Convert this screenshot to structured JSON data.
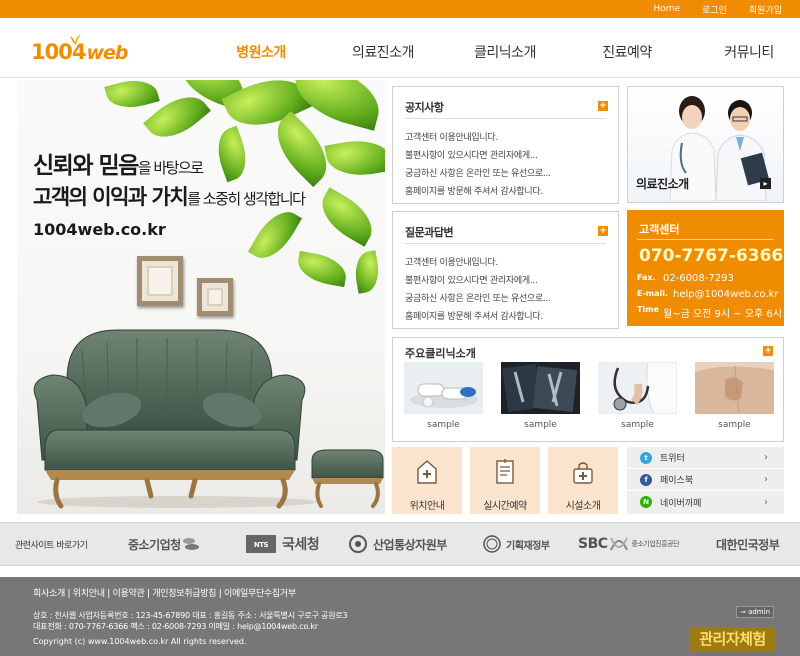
{
  "colors": {
    "accent": "#f08c00",
    "footer": "#777777",
    "quick": "#fbe4cd"
  },
  "topbar": {
    "links": [
      "Home",
      "로그인",
      "회원가입"
    ]
  },
  "logo": {
    "num": "1004",
    "text": "web"
  },
  "nav": {
    "items": [
      "병원소개",
      "의료진소개",
      "클리닉소개",
      "진료예약",
      "커뮤니티"
    ],
    "active": 0
  },
  "visual": {
    "line1_a": "신뢰와 믿음",
    "line1_b": "을 바탕으로",
    "line2_a": "고객의 이익과 가치",
    "line2_b": "를 소중히 생각합니다",
    "line3": "1004web.co.kr"
  },
  "notice": {
    "title": "공지사항",
    "items": [
      "고객센터 이용안내입니다.",
      "불편사항이 있으시다면 관리자에게...",
      "궁금하신 사항은 온라인 또는 유선으로...",
      "홈페이지를 방문해 주셔서 감사합니다."
    ]
  },
  "qna": {
    "title": "질문과답변",
    "items": [
      "고객센터 이용안내입니다.",
      "불편사항이 있으시다면 관리자에게...",
      "궁금하신 사항은 온라인 또는 유선으로...",
      "홈페이지를 방문해 주셔서 감사합니다."
    ]
  },
  "medical_staff": {
    "label": "의료진소개"
  },
  "customer_center": {
    "title": "고객센터",
    "phone": "070-7767-6366",
    "fax_label": "Fax.",
    "fax": "02-6008-7293",
    "email_label": "E-mail.",
    "email": "help@1004web.co.kr",
    "time_label": "Time",
    "time": "월~금 오전 9시 ~ 오후 6시"
  },
  "clinics": {
    "title": "주요클리닉소개",
    "items": [
      {
        "caption": "sample",
        "icon": "pills-image"
      },
      {
        "caption": "sample",
        "icon": "xray-image"
      },
      {
        "caption": "sample",
        "icon": "stethoscope-image"
      },
      {
        "caption": "sample",
        "icon": "back-massage-image"
      }
    ]
  },
  "quick": [
    {
      "label": "위치안내",
      "icon": "hospital-icon"
    },
    {
      "label": "실시간예약",
      "icon": "document-icon"
    },
    {
      "label": "시설소개",
      "icon": "medical-bag-icon"
    }
  ],
  "sns": [
    {
      "label": "트위터",
      "icon": "twitter-icon",
      "color": "#38a4dd"
    },
    {
      "label": "페이스북",
      "icon": "facebook-icon",
      "color": "#3b5998"
    },
    {
      "label": "네이버까페",
      "icon": "naver-icon",
      "color": "#2db400"
    }
  ],
  "related": {
    "label": "관련사이트 바로가기",
    "orgs": [
      "중소기업청",
      "국세청",
      "산업통상자원부",
      "기획재정부",
      "SBC",
      "중소기업진흥공단",
      "대한민국정부"
    ]
  },
  "footer": {
    "links": "회사소개 | 위치안내 | 이용약관 | 개인정보취급방침 | 이메일무단수집거부",
    "info1": "상호 : 천사웹   사업자등록번호 : 123-45-67890  대표 : 홍길동  주소 : 서울특별시 구로구 공원로3",
    "info2": "대표전화 : 070-7767-6366  팩스 : 02-6008-7293  이메일 : help@1004web.co.kr",
    "copyright": "Copyright (c) www.1004web.co.kr All rights reserved.",
    "admin_link": "admin",
    "admin_exp": "관리자체험"
  }
}
